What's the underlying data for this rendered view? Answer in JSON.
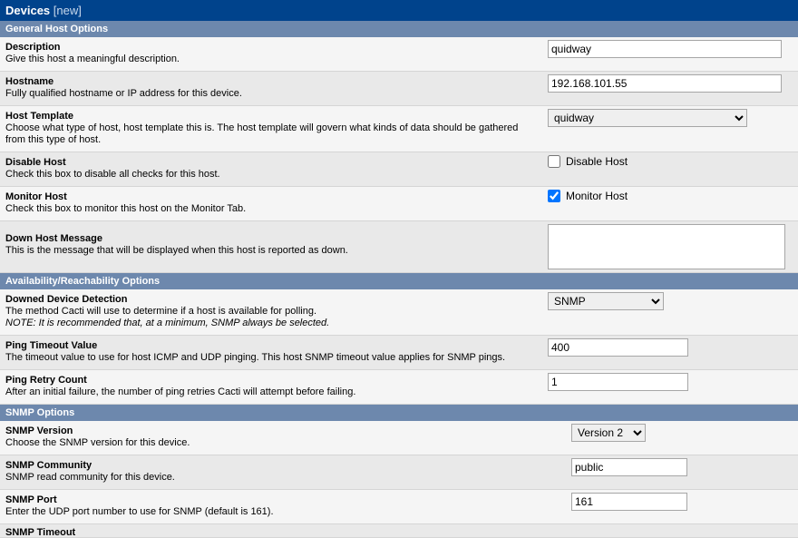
{
  "header": {
    "title": "Devices",
    "sub": "[new]"
  },
  "sections": {
    "general": "General Host Options",
    "avail": "Availability/Reachability Options",
    "snmp": "SNMP Options"
  },
  "fields": {
    "description": {
      "label": "Description",
      "desc": "Give this host a meaningful description.",
      "value": "quidway"
    },
    "hostname": {
      "label": "Hostname",
      "desc": "Fully qualified hostname or IP address for this device.",
      "value": "192.168.101.55"
    },
    "host_template": {
      "label": "Host Template",
      "desc": "Choose what type of host, host template this is. The host template will govern what kinds of data should be gathered from this type of host.",
      "selected": "quidway"
    },
    "disable_host": {
      "label": "Disable Host",
      "desc": "Check this box to disable all checks for this host.",
      "cblabel": "Disable Host"
    },
    "monitor_host": {
      "label": "Monitor Host",
      "desc": "Check this box to monitor this host on the Monitor Tab.",
      "cblabel": "Monitor Host"
    },
    "down_msg": {
      "label": "Down Host Message",
      "desc": "This is the message that will be displayed when this host is reported as down.",
      "value": ""
    },
    "downed_detect": {
      "label": "Downed Device Detection",
      "desc": "The method Cacti will use to determine if a host is available for polling.",
      "note": "NOTE: It is recommended that, at a minimum, SNMP always be selected.",
      "selected": "SNMP"
    },
    "ping_timeout": {
      "label": "Ping Timeout Value",
      "desc": "The timeout value to use for host ICMP and UDP pinging. This host SNMP timeout value applies for SNMP pings.",
      "value": "400"
    },
    "ping_retry": {
      "label": "Ping Retry Count",
      "desc": "After an initial failure, the number of ping retries Cacti will attempt before failing.",
      "value": "1"
    },
    "snmp_version": {
      "label": "SNMP Version",
      "desc": "Choose the SNMP version for this device.",
      "selected": "Version 2"
    },
    "snmp_community": {
      "label": "SNMP Community",
      "desc": "SNMP read community for this device.",
      "value": "public"
    },
    "snmp_port": {
      "label": "SNMP Port",
      "desc": "Enter the UDP port number to use for SNMP (default is 161).",
      "value": "161"
    },
    "snmp_timeout": {
      "label": "SNMP Timeout"
    }
  }
}
